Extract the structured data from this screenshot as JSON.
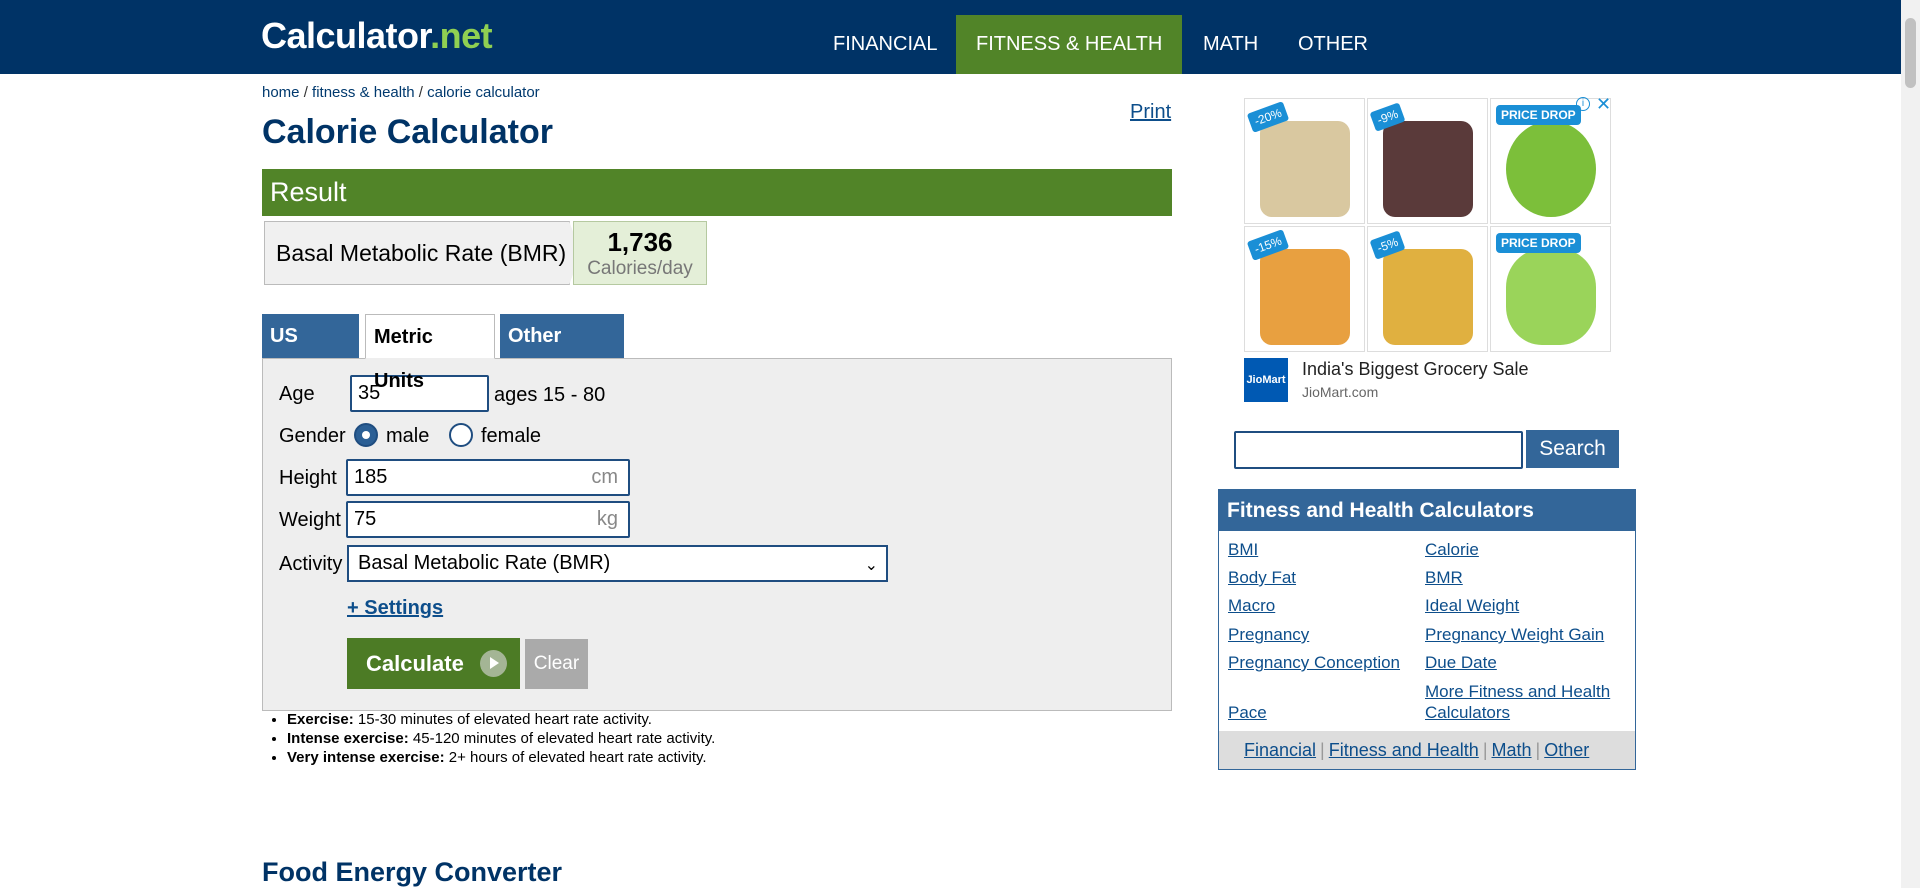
{
  "header": {
    "logo_main": "Calculator",
    "logo_dot": ".",
    "logo_suffix": "net",
    "nav": [
      "FINANCIAL",
      "FITNESS & HEALTH",
      "MATH",
      "OTHER"
    ]
  },
  "breadcrumb": {
    "home": "home",
    "fitness": "fitness & health",
    "current": "calorie calculator",
    "sep": " / "
  },
  "print_label": "Print",
  "page_title": "Calorie Calculator",
  "result": {
    "header": "Result",
    "label": "Basal Metabolic Rate (BMR)",
    "value": "1,736",
    "unit": "Calories/day"
  },
  "tabs": [
    "US Units",
    "Metric Units",
    "Other Units"
  ],
  "form": {
    "age_label": "Age",
    "age_value": "35",
    "age_hint": "ages 15 - 80",
    "gender_label": "Gender",
    "gender_male": "male",
    "gender_female": "female",
    "gender_selected": "male",
    "height_label": "Height",
    "height_value": "185",
    "height_unit": "cm",
    "weight_label": "Weight",
    "weight_value": "75",
    "weight_unit": "kg",
    "activity_label": "Activity",
    "activity_value": "Basal Metabolic Rate (BMR)",
    "settings_link": "+ Settings",
    "calculate_label": "Calculate",
    "clear_label": "Clear"
  },
  "notes": [
    {
      "term": "Exercise:",
      "desc": " 15-30 minutes of elevated heart rate activity."
    },
    {
      "term": "Intense exercise:",
      "desc": " 45-120 minutes of elevated heart rate activity."
    },
    {
      "term": "Very intense exercise:",
      "desc": " 2+ hours of elevated heart rate activity."
    }
  ],
  "food_title": "Food Energy Converter",
  "ad": {
    "badges": [
      "-20%",
      "-9%",
      "PRICE DROP",
      "-15%",
      "-5%",
      "PRICE DROP"
    ],
    "logo_text": "JioMart",
    "headline": "India's Biggest Grocery Sale",
    "domain": "JioMart.com",
    "info": "i",
    "close": "✕",
    "colors": [
      "#d9c8a0",
      "#5a3a3a",
      "#7cbf3a",
      "#e8a040",
      "#e0b040",
      "#9ad45a"
    ]
  },
  "search": {
    "button": "Search",
    "value": ""
  },
  "fitness_box": {
    "title": "Fitness and Health Calculators",
    "links_left": [
      "BMI",
      "Body Fat",
      "Macro",
      "Pregnancy",
      "Pregnancy Conception",
      "Pace"
    ],
    "links_right": [
      "Calorie",
      "BMR",
      "Ideal Weight",
      "Pregnancy Weight Gain",
      "Due Date",
      "More Fitness and Health Calculators"
    ],
    "footer": [
      "Financial",
      "Fitness and Health",
      "Math",
      "Other"
    ],
    "footer_sep": "|"
  },
  "colors": {
    "navy": "#003366",
    "green": "#518428",
    "blue": "#336699"
  }
}
